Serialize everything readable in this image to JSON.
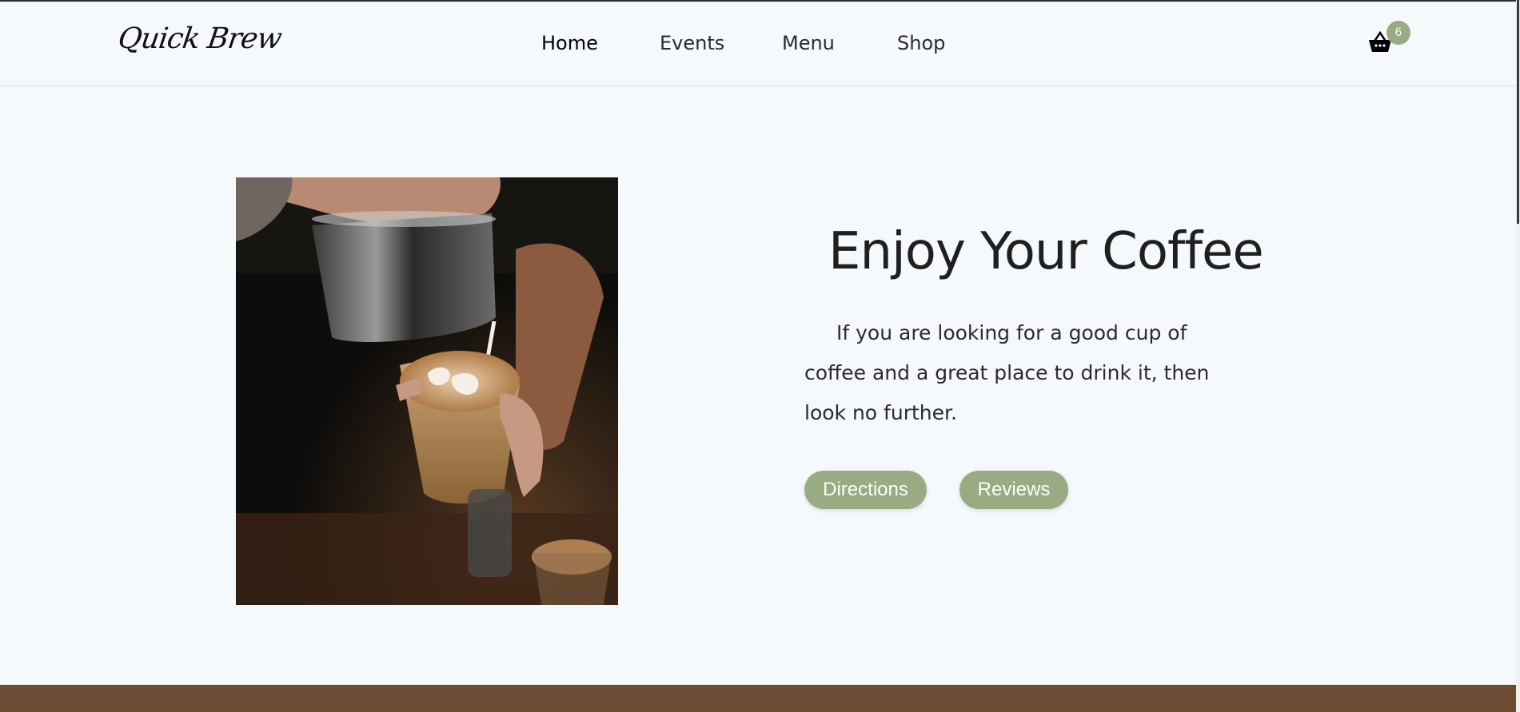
{
  "brand": {
    "logo_text": "Quick Brew"
  },
  "nav": {
    "items": [
      {
        "label": "Home"
      },
      {
        "label": "Events"
      },
      {
        "label": "Menu"
      },
      {
        "label": "Shop"
      }
    ],
    "active": "Home"
  },
  "cart": {
    "icon": "basket-icon",
    "count": "6"
  },
  "hero": {
    "image_alt": "Barista pouring latte art",
    "title": "Enjoy Your Coffee",
    "text": "If you are looking for a good cup of coffee and a great place to drink it, then look no further.",
    "buttons": {
      "directions_label": "Directions",
      "reviews_label": "Reviews"
    }
  },
  "colors": {
    "accent": "#98ab83",
    "footer": "#6e4b33",
    "background": "#f6f9fc"
  }
}
